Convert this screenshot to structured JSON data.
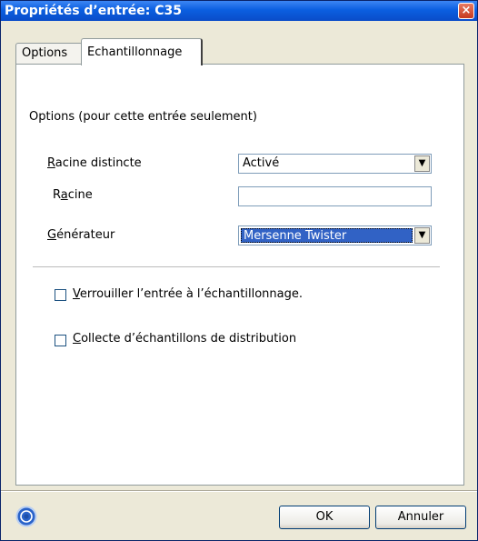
{
  "window": {
    "title": "Propriétés d’entrée: C35",
    "close_label": "×"
  },
  "tabs": [
    {
      "label": "Options",
      "active": false
    },
    {
      "label": "Echantillonnage",
      "active": true
    }
  ],
  "section_title": "Options (pour cette entrée seulement)",
  "fields": {
    "racine_distincte": {
      "label_mnemonic": "R",
      "label_rest": "acine distincte",
      "value": "Activé"
    },
    "racine": {
      "label_pre": "R",
      "label_mnemonic": "a",
      "label_rest": "cine",
      "value": ""
    },
    "generateur": {
      "label_mnemonic": "G",
      "label_rest": "énérateur",
      "value": "Mersenne Twister"
    }
  },
  "checkboxes": [
    {
      "label_mnemonic": "V",
      "label_rest": "errouiller l’entrée à l’échantillonnage.",
      "checked": false
    },
    {
      "label_mnemonic": "C",
      "label_rest": "ollecte d’échantillons de distribution",
      "checked": false
    }
  ],
  "buttons": {
    "ok": "OK",
    "cancel": "Annuler"
  },
  "colors": {
    "titlebar": "#0b5fe0",
    "selection": "#3162c5",
    "window_bg": "#ece9d8"
  },
  "icons": {
    "help": "help-icon",
    "close": "close-icon",
    "dropdown": "chevron-down-icon"
  }
}
